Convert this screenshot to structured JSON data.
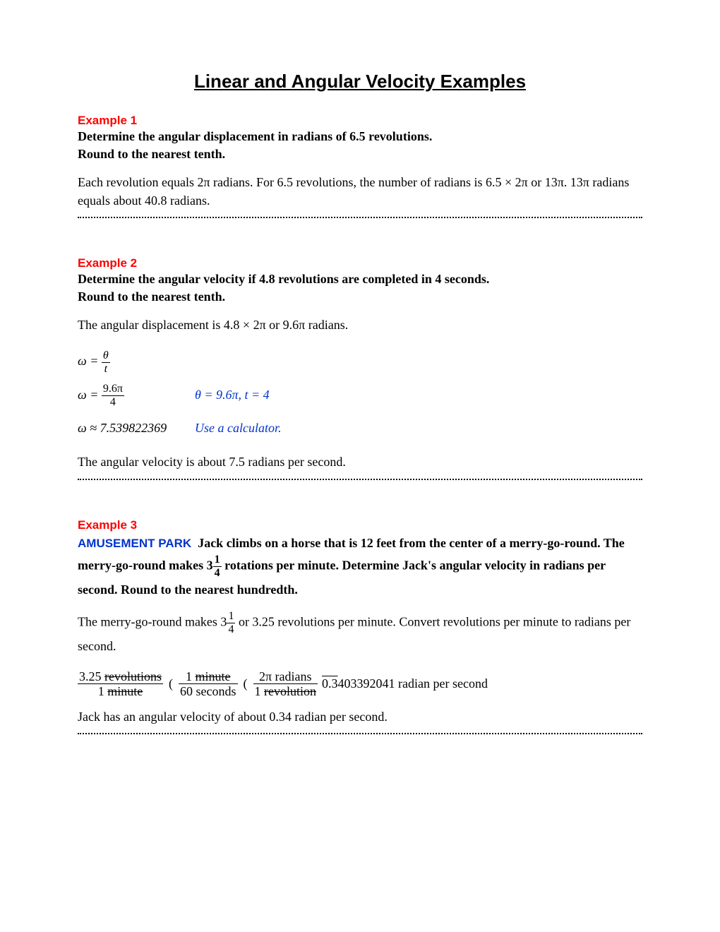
{
  "title": "Linear and Angular Velocity Examples",
  "examples": [
    {
      "heading": "Example 1",
      "prompt_line1": "Determine the angular displacement in radians of 6.5 revolutions.",
      "prompt_line2": "Round to the nearest tenth.",
      "body": "Each revolution equals 2π radians. For 6.5 revolutions, the number of radians is 6.5 × 2π or 13π. 13π radians equals about 40.8 radians."
    },
    {
      "heading": "Example 2",
      "prompt_line1": "Determine the angular velocity if 4.8 revolutions are completed in 4 seconds.",
      "prompt_line2": "Round to the nearest tenth.",
      "intro": "The angular displacement is 4.8 × 2π or 9.6π radians.",
      "eq1_lhs": "ω =",
      "eq1_num": "θ",
      "eq1_den": "t",
      "eq2_lhs": "ω =",
      "eq2_num": "9.6π",
      "eq2_den": "4",
      "eq2_note": "θ = 9.6π, t = 4",
      "eq3": "ω ≈ 7.539822369",
      "eq3_note": "Use a calculator.",
      "conclusion": "The angular velocity is about 7.5 radians per second."
    },
    {
      "heading": "Example 3",
      "context_label": "AMUSEMENT PARK",
      "prompt_part1": "Jack climbs on a horse that is 12 feet from the center of a merry-go-round. The merry-go-round makes 3",
      "mixed_num": "1",
      "mixed_den": "4",
      "prompt_part2": " rotations per minute. Determine Jack's angular velocity in radians per second. Round to the nearest hundredth.",
      "body_part1": "The merry-go-round makes 3",
      "body_num": "1",
      "body_den": "4",
      "body_part2": " or 3.25 revolutions per minute. Convert revolutions per minute to radians per second.",
      "f1_num_a": "3.25 ",
      "f1_num_b": "revolutions",
      "f1_den_a": "1 ",
      "f1_den_b": "minute",
      "f2_num_a": "1 ",
      "f2_num_b": "minute",
      "f2_den": "60 seconds",
      "f3_num": "2π radians",
      "f3_den_a": "1 ",
      "f3_den_b": "revolution",
      "result_prefix": "0.3",
      "result_rest": "403392041 radian per second",
      "conclusion": "Jack has an angular velocity of about 0.34 radian per second."
    }
  ]
}
